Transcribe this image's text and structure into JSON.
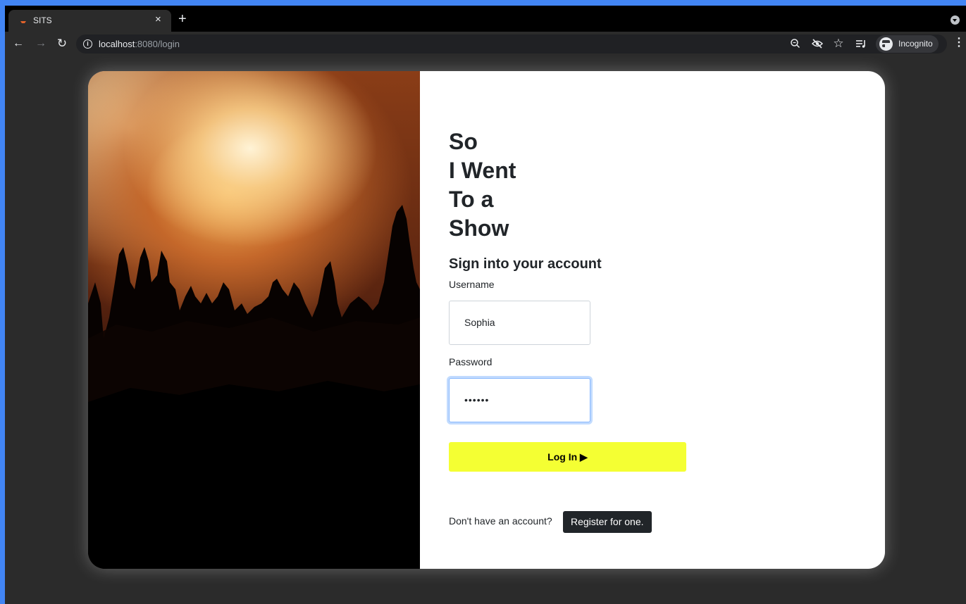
{
  "browser": {
    "tab_title": "SITS",
    "tab_close": "×",
    "new_tab": "+",
    "url_host": "localhost",
    "url_rest": ":8080/login",
    "profile_label": "Incognito",
    "icons": [
      "back-arrow-icon",
      "forward-arrow-icon",
      "reload-icon",
      "info-icon",
      "zoom-icon",
      "eye-off-icon",
      "star-icon",
      "media-queue-icon",
      "incognito-icon",
      "kebab-menu-icon"
    ]
  },
  "hero": {
    "image": "concert-crowd-photo",
    "colors": {
      "light": "#fff3d6",
      "mid": "#f7b65a",
      "deep": "#8a3d17",
      "shadow": "#000000"
    }
  },
  "login": {
    "title_lines": [
      "So",
      "I Went",
      "To a",
      "Show"
    ],
    "subtitle": "Sign into your account",
    "username_label": "Username",
    "username_value": "Sophia",
    "password_label": "Password",
    "password_value": "••••••",
    "login_label": "Log In ▶",
    "no_account_text": "Don't have an account?",
    "register_label": "Register for one.",
    "accent_color": "#f4ff33"
  }
}
